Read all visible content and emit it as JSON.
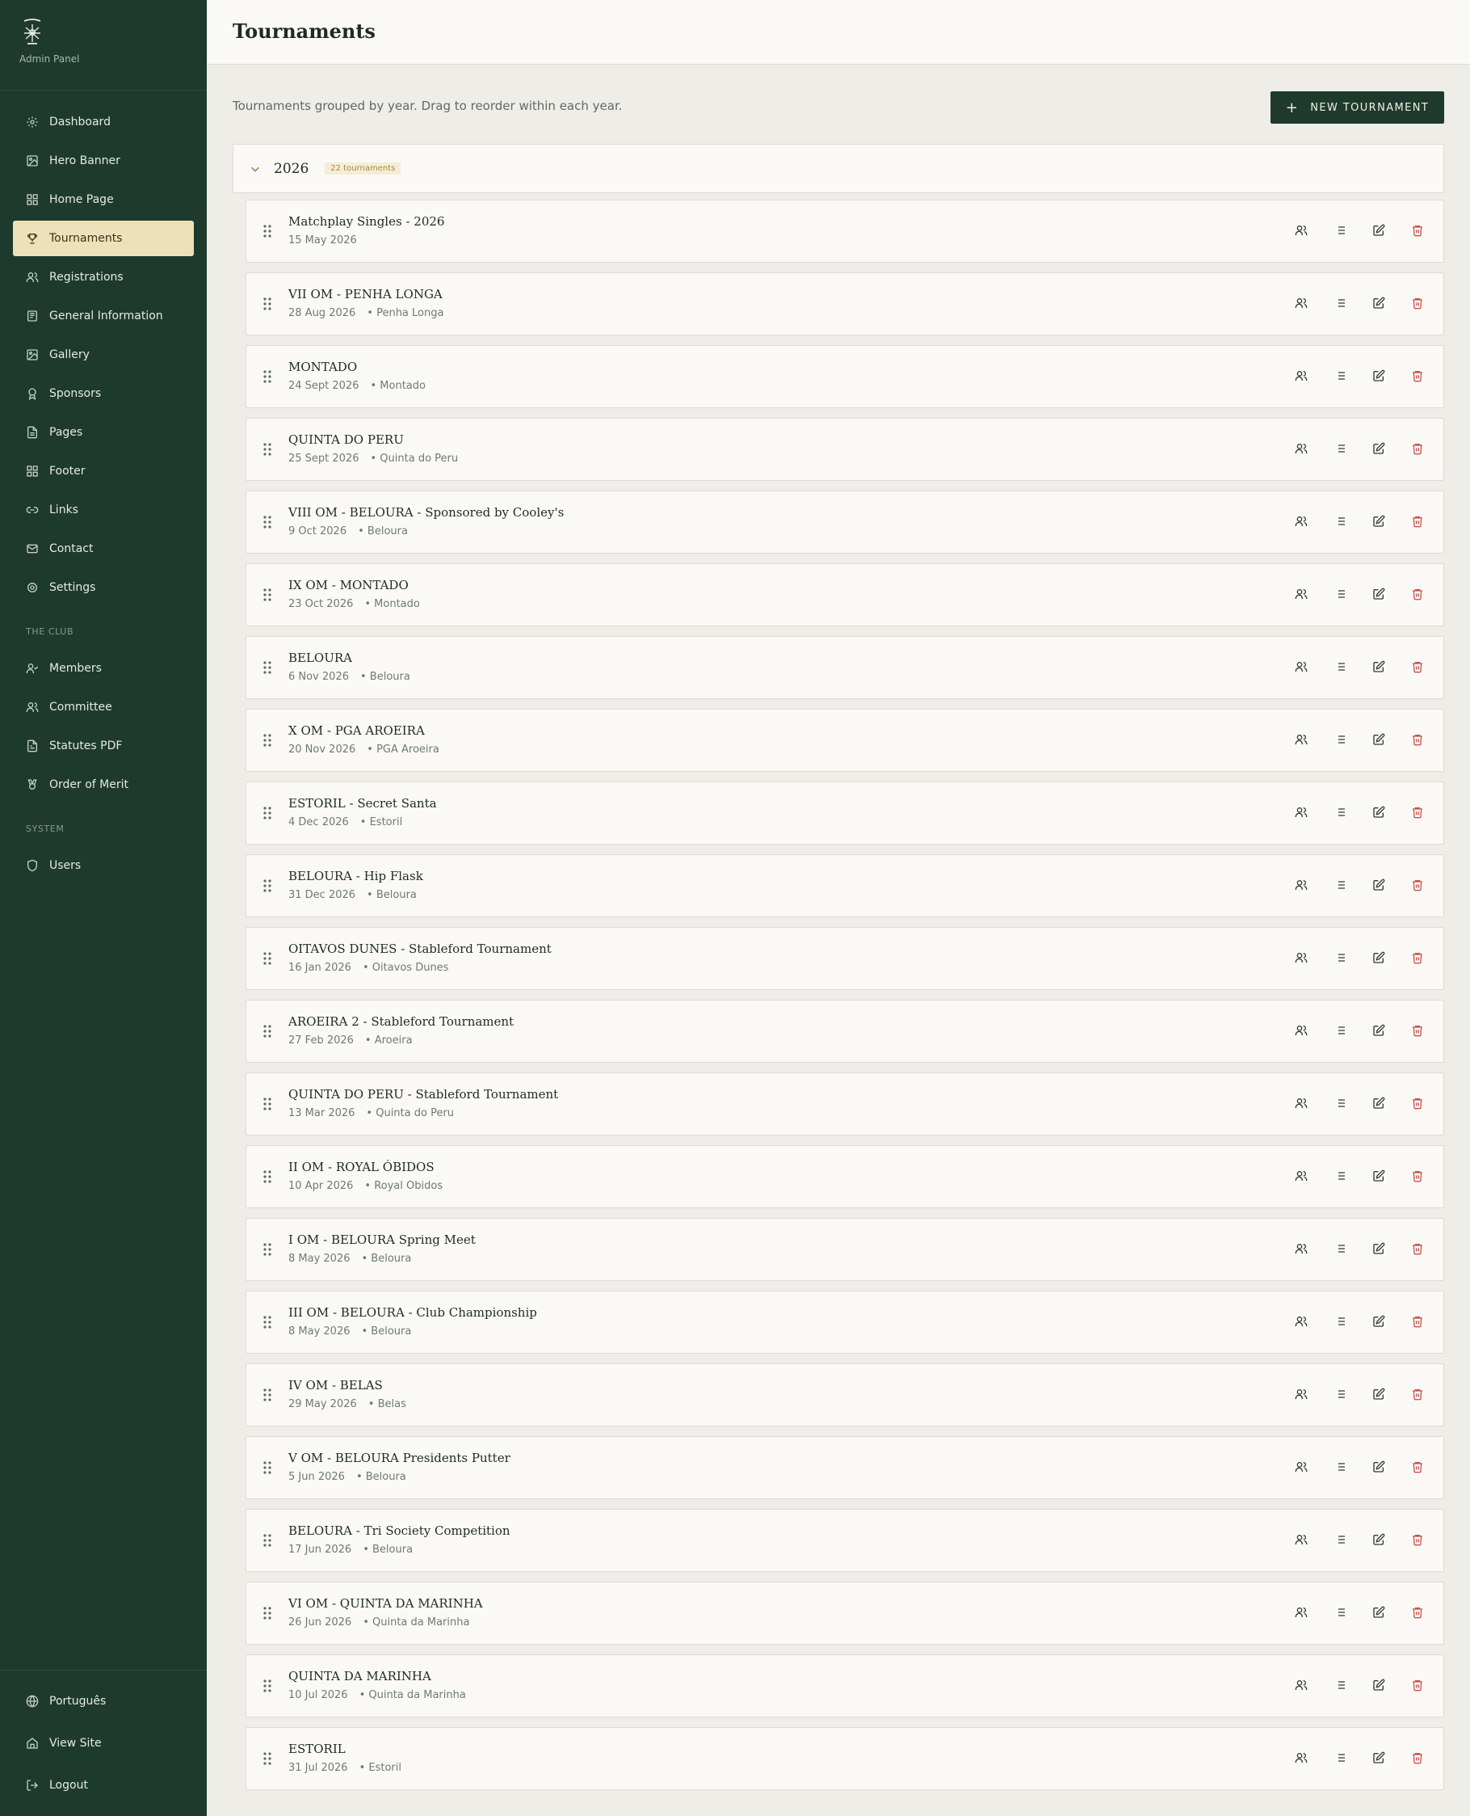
{
  "app": {
    "brand_sub": "Admin Panel",
    "page_title": "Tournaments"
  },
  "sidebar": {
    "main": [
      {
        "label": "Dashboard",
        "icon": "gear-icon"
      },
      {
        "label": "Hero Banner",
        "icon": "image-icon"
      },
      {
        "label": "Home Page",
        "icon": "grid-icon"
      },
      {
        "label": "Tournaments",
        "icon": "trophy-icon",
        "active": true
      },
      {
        "label": "Registrations",
        "icon": "users-icon"
      },
      {
        "label": "General Information",
        "icon": "newspaper-icon"
      },
      {
        "label": "Gallery",
        "icon": "image-icon"
      },
      {
        "label": "Sponsors",
        "icon": "award-icon"
      },
      {
        "label": "Pages",
        "icon": "file-icon"
      },
      {
        "label": "Footer",
        "icon": "grid-icon"
      },
      {
        "label": "Links",
        "icon": "link-icon"
      },
      {
        "label": "Contact",
        "icon": "mail-icon"
      },
      {
        "label": "Settings",
        "icon": "settings-icon"
      }
    ],
    "club_section": "THE CLUB",
    "club": [
      {
        "label": "Members",
        "icon": "user-check-icon"
      },
      {
        "label": "Committee",
        "icon": "users-icon"
      },
      {
        "label": "Statutes PDF",
        "icon": "file-text-icon"
      },
      {
        "label": "Order of Merit",
        "icon": "medal-icon"
      }
    ],
    "system_section": "SYSTEM",
    "system": [
      {
        "label": "Users",
        "icon": "shield-icon"
      }
    ],
    "bottom": [
      {
        "label": "Português",
        "icon": "globe-icon"
      },
      {
        "label": "View Site",
        "icon": "home-icon"
      },
      {
        "label": "Logout",
        "icon": "logout-icon"
      }
    ]
  },
  "main": {
    "description": "Tournaments grouped by year. Drag to reorder within each year.",
    "new_button": "NEW TOURNAMENT",
    "group": {
      "year": "2026",
      "count": "22 tournaments"
    },
    "tournaments": [
      {
        "title": "Matchplay Singles - 2026",
        "date": "15 May 2026",
        "venue": ""
      },
      {
        "title": "VII OM - PENHA LONGA",
        "date": "28 Aug 2026",
        "venue": "• Penha Longa"
      },
      {
        "title": "MONTADO",
        "date": "24 Sept 2026",
        "venue": "• Montado"
      },
      {
        "title": "QUINTA DO PERU",
        "date": "25 Sept 2026",
        "venue": "• Quinta do Peru"
      },
      {
        "title": "VIII OM - BELOURA - Sponsored by Cooley's",
        "date": "9 Oct 2026",
        "venue": "• Beloura"
      },
      {
        "title": "IX OM - MONTADO",
        "date": "23 Oct 2026",
        "venue": "• Montado"
      },
      {
        "title": "BELOURA",
        "date": "6 Nov 2026",
        "venue": "• Beloura"
      },
      {
        "title": "X OM - PGA AROEIRA",
        "date": "20 Nov 2026",
        "venue": "• PGA Aroeira"
      },
      {
        "title": "ESTORIL - Secret Santa",
        "date": "4 Dec 2026",
        "venue": "• Estoril"
      },
      {
        "title": "BELOURA - Hip Flask",
        "date": "31 Dec 2026",
        "venue": "• Beloura"
      },
      {
        "title": "OITAVOS DUNES - Stableford Tournament",
        "date": "16 Jan 2026",
        "venue": "• Oitavos Dunes"
      },
      {
        "title": "AROEIRA 2 - Stableford Tournament",
        "date": "27 Feb 2026",
        "venue": "• Aroeira"
      },
      {
        "title": "QUINTA DO PERU - Stableford Tournament",
        "date": "13 Mar 2026",
        "venue": "• Quinta do Peru"
      },
      {
        "title": "II OM - ROYAL ÓBIDOS",
        "date": "10 Apr 2026",
        "venue": "• Royal Obidos"
      },
      {
        "title": "I OM - BELOURA Spring Meet",
        "date": "8 May 2026",
        "venue": "• Beloura"
      },
      {
        "title": "III OM - BELOURA - Club Championship",
        "date": "8 May 2026",
        "venue": "• Beloura"
      },
      {
        "title": "IV OM - BELAS",
        "date": "29 May 2026",
        "venue": "• Belas"
      },
      {
        "title": "V OM - BELOURA Presidents Putter",
        "date": "5 Jun 2026",
        "venue": "• Beloura"
      },
      {
        "title": "BELOURA - Tri Society Competition",
        "date": "17 Jun 2026",
        "venue": "• Beloura"
      },
      {
        "title": "VI OM - QUINTA DA MARINHA",
        "date": "26 Jun 2026",
        "venue": "• Quinta da Marinha"
      },
      {
        "title": "QUINTA DA MARINHA",
        "date": "10 Jul 2026",
        "venue": "• Quinta da Marinha"
      },
      {
        "title": "ESTORIL",
        "date": "31 Jul 2026",
        "venue": "• Estoril"
      }
    ]
  },
  "colors": {
    "sidebar_bg": "#1E3A2D",
    "active_bg": "#ECE1B8",
    "accent_gold": "#B08A3A",
    "danger": "#C7544E"
  }
}
